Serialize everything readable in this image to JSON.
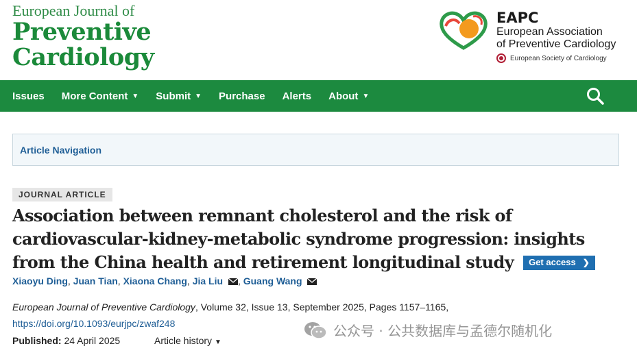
{
  "header": {
    "journal_line1": "European Journal of",
    "journal_line2": "Preventive",
    "journal_line3": "Cardiology",
    "society_acronym": "EAPC",
    "society_name_line1": "European Association",
    "society_name_line2": "of Preventive Cardiology",
    "parent_society": "European Society of Cardiology"
  },
  "nav": {
    "items": [
      {
        "label": "Issues",
        "has_dropdown": false
      },
      {
        "label": "More Content",
        "has_dropdown": true
      },
      {
        "label": "Submit",
        "has_dropdown": true
      },
      {
        "label": "Purchase",
        "has_dropdown": false
      },
      {
        "label": "Alerts",
        "has_dropdown": false
      },
      {
        "label": "About",
        "has_dropdown": true
      }
    ],
    "search_icon": "search-icon",
    "bg_color": "#1c8a3f"
  },
  "article_navigation": {
    "label": "Article Navigation"
  },
  "article": {
    "type_badge": "JOURNAL ARTICLE",
    "title": "Association between remnant cholesterol and the risk of cardiovascular-kidney-metabolic syndrome progression: insights from the China health and retirement longitudinal study",
    "get_access_label": "Get access",
    "authors": [
      {
        "name": "Xiaoyu Ding",
        "corresponding": false
      },
      {
        "name": "Juan Tian",
        "corresponding": false
      },
      {
        "name": "Xiaona Chang",
        "corresponding": false
      },
      {
        "name": "Jia Liu",
        "corresponding": true
      },
      {
        "name": "Guang Wang",
        "corresponding": true
      }
    ],
    "citation_journal": "European Journal of Preventive Cardiology",
    "citation_details": ", Volume 32, Issue 13, September 2025, Pages 1157–1165,",
    "doi": "https://doi.org/10.1093/eurjpc/zwaf248",
    "published_label": "Published:",
    "published_date": "24 April 2025",
    "history_label": "Article history"
  },
  "watermark": {
    "text": "公众号 · 公共数据库与孟德尔随机化"
  },
  "colors": {
    "brand_green": "#1b8a3a",
    "link_blue": "#1f5e96",
    "button_blue": "#1f6fb1"
  }
}
